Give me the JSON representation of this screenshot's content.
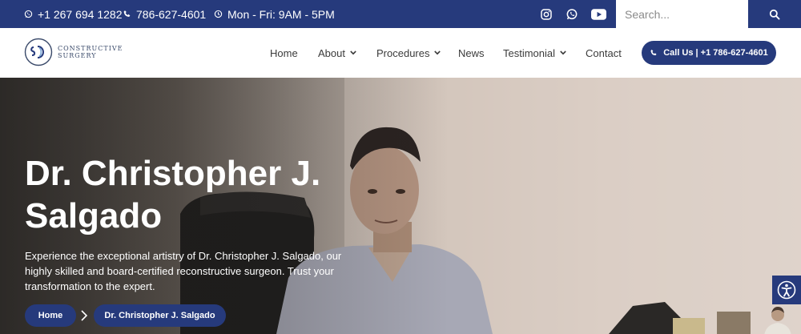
{
  "topbar": {
    "phone_primary": "+1 267 694 1282",
    "phone_secondary": "786-627-4601",
    "hours": "Mon - Fri: 9AM - 5PM",
    "social_icons": [
      "instagram-icon",
      "whatsapp-icon",
      "youtube-icon"
    ],
    "search_placeholder": "Search...",
    "search_icon": "search-icon"
  },
  "header": {
    "logo_line1": "CONSTRUCTIVE",
    "logo_line2": "SURGERY",
    "nav": {
      "home": "Home",
      "about": "About",
      "procedures": "Procedures",
      "news": "News",
      "testimonial": "Testimonial",
      "contact": "Contact"
    },
    "call_label": "Call Us | +1 786-627-4601"
  },
  "hero": {
    "title": "Dr. Christopher J. Salgado",
    "description": "Experience the exceptional artistry of Dr. Christopher J. Salgado, our highly skilled and board-certified reconstructive surgeon. Trust your transformation to the expert.",
    "breadcrumb_home": "Home",
    "breadcrumb_current": "Dr. Christopher J. Salgado"
  },
  "colors": {
    "brand_navy": "#263a7c",
    "nav_text": "#3b3b3b",
    "white": "#ffffff"
  }
}
